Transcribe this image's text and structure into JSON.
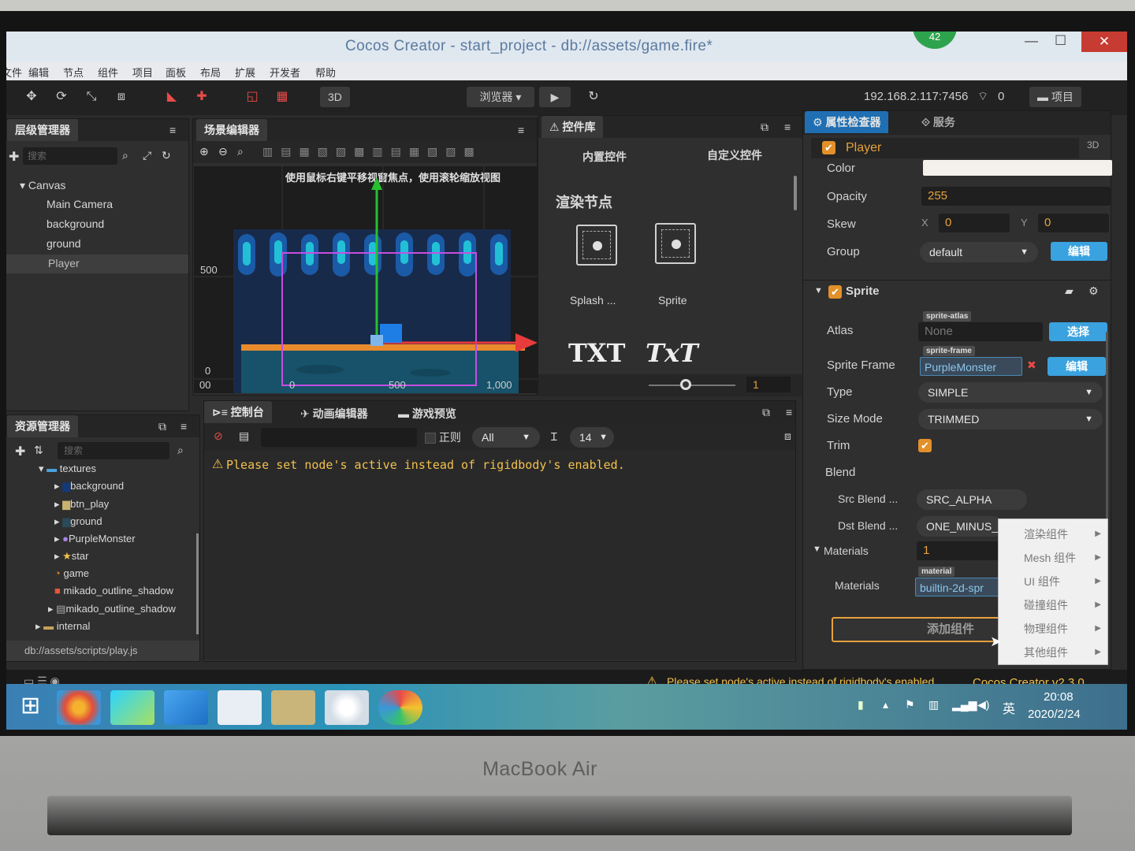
{
  "window": {
    "title": "Cocos Creator - start_project - db://assets/game.fire*",
    "fps_badge": "42",
    "minimize": "—",
    "maximize": "☐",
    "close": "✕"
  },
  "menu": [
    "文件",
    "编辑",
    "节点",
    "组件",
    "项目",
    "面板",
    "布局",
    "扩展",
    "开发者",
    "帮助"
  ],
  "toolbar": {
    "mode_3d": "3D",
    "preview_target": "浏览器",
    "ip": "192.168.2.117:7456",
    "connections": "0",
    "project_button": "项目"
  },
  "hierarchy": {
    "tab": "层级管理器",
    "search_placeholder": "搜索",
    "nodes": [
      "Canvas",
      "Main Camera",
      "background",
      "ground",
      "Player"
    ],
    "selected": "Player"
  },
  "scene": {
    "tab": "场景编辑器",
    "hint": "使用鼠标右键平移视窗焦点，使用滚轮缩放视图",
    "y_ticks": [
      "500",
      "0"
    ],
    "x_ticks": [
      "00",
      "0",
      "500",
      "1,000"
    ]
  },
  "widgets": {
    "tab": "控件库",
    "builtin_tab": "内置控件",
    "custom_tab": "自定义控件",
    "section": "渲染节点",
    "items": [
      "Splash ...",
      "Sprite"
    ],
    "txt_items": [
      "TXT",
      "TxT"
    ],
    "zoom_value": "1"
  },
  "assets": {
    "tab": "资源管理器",
    "search_placeholder": "搜索",
    "items": [
      "textures",
      "background",
      "btn_play",
      "ground",
      "PurpleMonster",
      "star",
      "game",
      "mikado_outline_shadow",
      "mikado_outline_shadow",
      "internal"
    ],
    "footer_path": "db://assets/scripts/play.js"
  },
  "console": {
    "tabs": [
      "控制台",
      "动画编辑器",
      "游戏预览"
    ],
    "regex_label": "正则",
    "filter": "All",
    "font_size": "14",
    "message": "Please set node's active instead of rigidbody's enabled."
  },
  "inspector": {
    "tab": "属性检查器",
    "service_tab": "服务",
    "mode_3d": "3D",
    "node_name": "Player",
    "color_label": "Color",
    "opacity_label": "Opacity",
    "opacity": "255",
    "skew_label": "Skew",
    "skew_x_label": "X",
    "skew_x": "0",
    "skew_y_label": "Y",
    "skew_y": "0",
    "group_label": "Group",
    "group": "default",
    "edit_button": "编辑",
    "sprite_section": "Sprite",
    "atlas_label": "Atlas",
    "atlas_tag": "sprite-atlas",
    "atlas_value": "None",
    "select_button": "选择",
    "sprite_frame_label": "Sprite Frame",
    "sprite_frame_tag": "sprite-frame",
    "sprite_frame_value": "PurpleMonster",
    "edit_button2": "编辑",
    "type_label": "Type",
    "type": "SIMPLE",
    "size_mode_label": "Size Mode",
    "size_mode": "TRIMMED",
    "trim_label": "Trim",
    "blend_label": "Blend",
    "src_blend_label": "Src Blend ...",
    "src_blend": "SRC_ALPHA",
    "dst_blend_label": "Dst Blend ...",
    "dst_blend": "ONE_MINUS_S",
    "materials_section": "Materials",
    "materials_count": "1",
    "materials_label": "Materials",
    "material_tag": "material",
    "material_value": "builtin-2d-spr",
    "add_component": "添加组件"
  },
  "context_menu": [
    "渲染组件",
    "Mesh 组件",
    "UI 组件",
    "碰撞组件",
    "物理组件",
    "其他组件"
  ],
  "statusbar": {
    "message": "Please set node's active instead of rigidbody's enabled.",
    "version": "Cocos Creator v2.3.0"
  },
  "taskbar": {
    "ime": "英",
    "time": "20:08",
    "date": "2020/2/24"
  },
  "device": {
    "brand": "MacBook Air"
  },
  "colors": {
    "accent_blue": "#3aa2df",
    "warn_yellow": "#f2c14e",
    "orange": "#e6a23c",
    "close_red": "#c63c32"
  }
}
